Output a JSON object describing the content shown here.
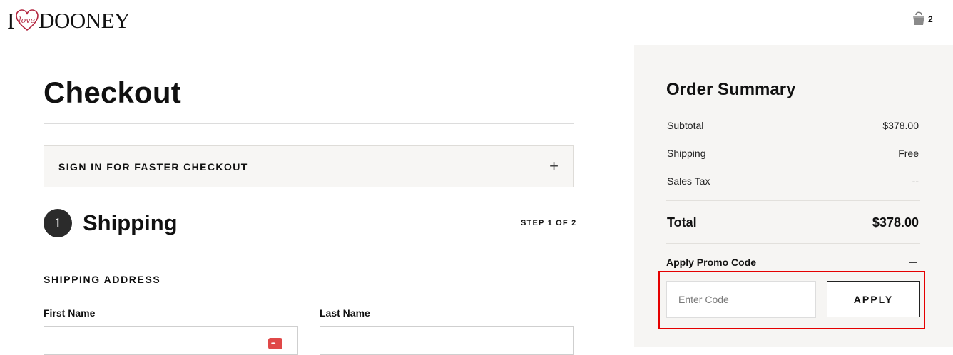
{
  "header": {
    "logo": {
      "prefix": "I",
      "heart_text": "love",
      "wordmark": "DOONEY"
    },
    "cart": {
      "icon": "shopping-bag-icon",
      "count": "2"
    }
  },
  "checkout": {
    "title": "Checkout",
    "signin_label": "SIGN IN FOR FASTER CHECKOUT",
    "signin_icon": "plus-icon",
    "step_number": "1",
    "section_title": "Shipping",
    "step_indicator": "STEP 1 OF 2",
    "address_label": "SHIPPING ADDRESS",
    "fields": {
      "first_name": "First Name",
      "last_name": "Last Name"
    }
  },
  "summary": {
    "title": "Order Summary",
    "rows": [
      {
        "label": "Subtotal",
        "value": "$378.00"
      },
      {
        "label": "Shipping",
        "value": "Free"
      },
      {
        "label": "Sales Tax",
        "value": "--"
      }
    ],
    "total_label": "Total",
    "total_value": "$378.00",
    "promo_label": "Apply Promo Code",
    "promo_placeholder": "Enter Code",
    "apply_label": "APPLY"
  },
  "colors": {
    "accent_heart": "#b3263f",
    "summary_bg": "#f6f5f3",
    "highlight": "#e50000",
    "autofill_icon": "#e04848"
  }
}
